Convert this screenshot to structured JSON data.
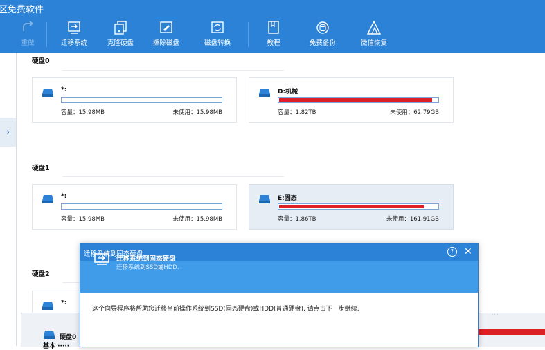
{
  "window": {
    "title": "区免费软件"
  },
  "toolbar": {
    "items": [
      {
        "label": "重做"
      },
      {
        "label": "迁移系统"
      },
      {
        "label": "克隆硬盘"
      },
      {
        "label": "擦除磁盘"
      },
      {
        "label": "磁盘转换"
      },
      {
        "label": "教程"
      },
      {
        "label": "免费备份"
      },
      {
        "label": "微信恢复"
      }
    ]
  },
  "left_panel": {
    "toggle": "›"
  },
  "disks": [
    {
      "title": "硬盘0",
      "partitions": [
        {
          "name": "*:",
          "capacity": "容量：15.98MB",
          "unused": "未使用：15.98MB",
          "used_fraction": 0
        },
        {
          "name": "D:机械",
          "capacity": "容量：1.82TB",
          "unused": "未使用：62.79GB",
          "used_fraction": 0.966
        }
      ]
    },
    {
      "title": "硬盘1",
      "partitions": [
        {
          "name": "*:",
          "capacity": "容量：15.98MB",
          "unused": "未使用：15.98MB",
          "used_fraction": 0
        },
        {
          "name": "E:固态",
          "capacity": "容量：1.86TB",
          "unused": "未使用：161.91GB",
          "used_fraction": 0.915
        }
      ]
    },
    {
      "title": "硬盘2",
      "partitions": [
        {
          "name": "*:"
        }
      ]
    }
  ],
  "bottom_panel": {
    "disk_name": "硬盘0",
    "sub": "基本 ·····"
  },
  "dialog": {
    "title": "迁移系统到固态硬盘",
    "help": "?",
    "close": "✕",
    "banner_title": "迁移系统到固态硬盘",
    "banner_subtitle": "迁移系统到SSD或HDD.",
    "body": "这个向导程序将帮助您迁移当前操作系统到SSD(固态硬盘)或HDD(普通硬盘). 请点击下一步继续."
  },
  "colors": {
    "accent": "#2b82d7",
    "banner": "#409be8",
    "used_bar": "#dd1f26"
  }
}
